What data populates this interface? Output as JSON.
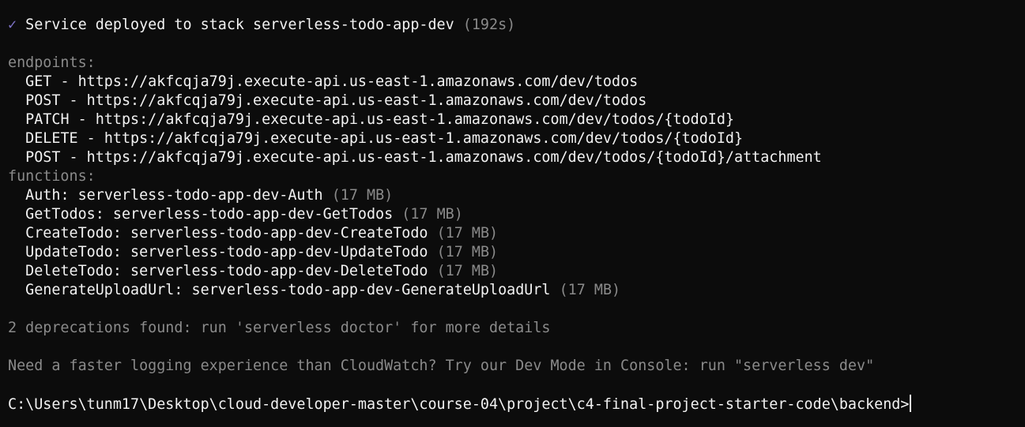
{
  "deploy": {
    "check_icon": "✓",
    "message": "Service deployed to stack serverless-todo-app-dev",
    "duration": "(192s)"
  },
  "endpoints": {
    "heading": "endpoints:",
    "items": [
      {
        "method": "GET",
        "url": "https://akfcqja79j.execute-api.us-east-1.amazonaws.com/dev/todos"
      },
      {
        "method": "POST",
        "url": "https://akfcqja79j.execute-api.us-east-1.amazonaws.com/dev/todos"
      },
      {
        "method": "PATCH",
        "url": "https://akfcqja79j.execute-api.us-east-1.amazonaws.com/dev/todos/{todoId}"
      },
      {
        "method": "DELETE",
        "url": "https://akfcqja79j.execute-api.us-east-1.amazonaws.com/dev/todos/{todoId}"
      },
      {
        "method": "POST",
        "url": "https://akfcqja79j.execute-api.us-east-1.amazonaws.com/dev/todos/{todoId}/attachment"
      }
    ]
  },
  "functions": {
    "heading": "functions:",
    "items": [
      {
        "name": "Auth",
        "resource": "serverless-todo-app-dev-Auth",
        "size": "(17 MB)"
      },
      {
        "name": "GetTodos",
        "resource": "serverless-todo-app-dev-GetTodos",
        "size": "(17 MB)"
      },
      {
        "name": "CreateTodo",
        "resource": "serverless-todo-app-dev-CreateTodo",
        "size": "(17 MB)"
      },
      {
        "name": "UpdateTodo",
        "resource": "serverless-todo-app-dev-UpdateTodo",
        "size": "(17 MB)"
      },
      {
        "name": "DeleteTodo",
        "resource": "serverless-todo-app-dev-DeleteTodo",
        "size": "(17 MB)"
      },
      {
        "name": "GenerateUploadUrl",
        "resource": "serverless-todo-app-dev-GenerateUploadUrl",
        "size": "(17 MB)"
      }
    ]
  },
  "deprecations_notice": "2 deprecations found: run 'serverless doctor' for more details",
  "dev_mode_notice": "Need a faster logging experience than CloudWatch? Try our Dev Mode in Console: run \"serverless dev\"",
  "prompt": "C:\\Users\\tunm17\\Desktop\\cloud-developer-master\\course-04\\project\\c4-final-project-starter-code\\backend>",
  "colors": {
    "background": "#0c0c0c",
    "text": "#f2f2f2",
    "dim": "#8a8a8a",
    "check": "#7d72c6"
  }
}
